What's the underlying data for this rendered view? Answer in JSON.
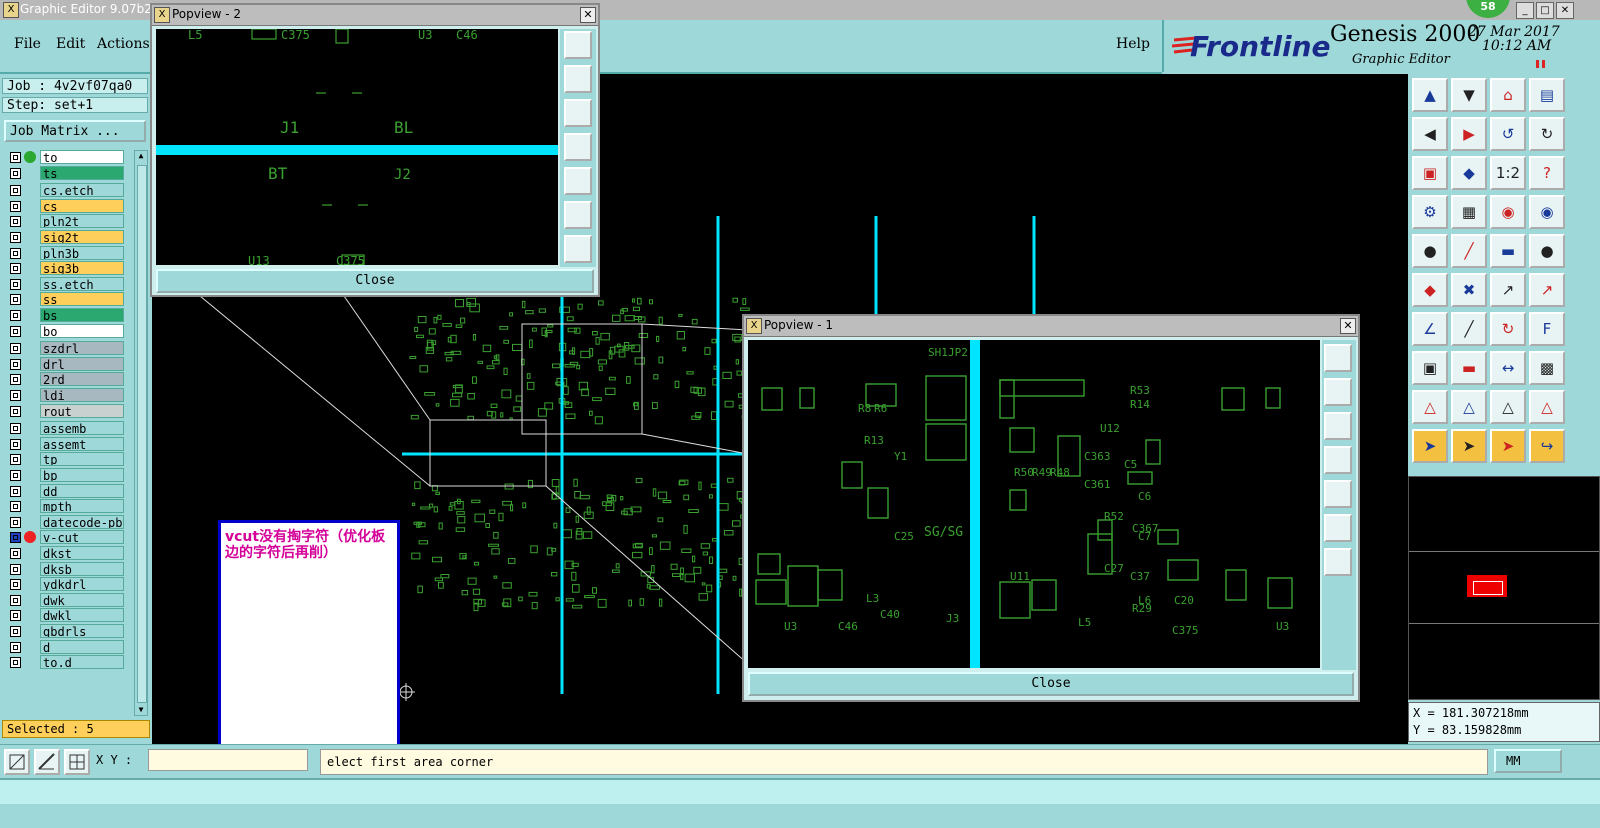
{
  "window": {
    "title": "Graphic Editor 9.07b2 (",
    "badge": "58"
  },
  "menu": {
    "file": "File",
    "edit": "Edit",
    "actions": "Actions",
    "help": "Help"
  },
  "brand": {
    "logo": "Frontline",
    "product": "Genesis 2000",
    "subtitle": "Graphic Editor",
    "date": "27 Mar 2017",
    "time": "10:12 AM"
  },
  "job": {
    "job_line": "Job : 4v2vf07qa0",
    "step_line": "Step: set+1",
    "matrix_button": "Job Matrix ..."
  },
  "layers": [
    {
      "name": "to",
      "color": "#ffffff"
    },
    {
      "name": "ts",
      "color": "#2aa870"
    },
    {
      "name": "cs.etch",
      "color": "#9fd8d8"
    },
    {
      "name": "cs",
      "color": "#ffcf5c"
    },
    {
      "name": "pln2t",
      "color": "#9fd8d8"
    },
    {
      "name": "sig2t",
      "color": "#ffcf5c"
    },
    {
      "name": "pln3b",
      "color": "#9fd8d8"
    },
    {
      "name": "sig3b",
      "color": "#ffcf5c"
    },
    {
      "name": "ss.etch",
      "color": "#9fd8d8"
    },
    {
      "name": "ss",
      "color": "#ffcf5c"
    },
    {
      "name": "bs",
      "color": "#2aa870"
    },
    {
      "name": "bo",
      "color": "#ffffff"
    },
    {
      "name": "szdrl",
      "color": "#a8b8c0"
    },
    {
      "name": "drl",
      "color": "#a8b8c0"
    },
    {
      "name": "2rd",
      "color": "#a8b8c0"
    },
    {
      "name": "ldi",
      "color": "#a8b8c0"
    },
    {
      "name": "rout",
      "color": "#c8d0d0"
    },
    {
      "name": "assemb",
      "color": "#9fd8d8"
    },
    {
      "name": "assemt",
      "color": "#9fd8d8"
    },
    {
      "name": "tp",
      "color": "#9fd8d8"
    },
    {
      "name": "bp",
      "color": "#9fd8d8"
    },
    {
      "name": "dd",
      "color": "#9fd8d8"
    },
    {
      "name": "mpth",
      "color": "#9fd8d8"
    },
    {
      "name": "datecode-pbe",
      "color": "#9fd8d8"
    },
    {
      "name": "v-cut",
      "color": "#9fd8d8"
    },
    {
      "name": "dkst",
      "color": "#9fd8d8"
    },
    {
      "name": "dksb",
      "color": "#9fd8d8"
    },
    {
      "name": "ydkdrl",
      "color": "#9fd8d8"
    },
    {
      "name": "dwk",
      "color": "#9fd8d8"
    },
    {
      "name": "dwkl",
      "color": "#9fd8d8"
    },
    {
      "name": "gbdrls",
      "color": "#9fd8d8"
    },
    {
      "name": "d",
      "color": "#9fd8d8"
    },
    {
      "name": "to.d",
      "color": "#9fd8d8"
    }
  ],
  "selected": "Selected : 5",
  "popview2": {
    "title": "Popview - 2",
    "close": "Close",
    "labels": {
      "l1": "C375",
      "l2": "U3",
      "l3": "C46",
      "l4": "L5",
      "l5": "J1",
      "l6": "BL",
      "l7": "BT",
      "l8": "J2",
      "l9": "U13",
      "l10": "C375"
    }
  },
  "popview1": {
    "title": "Popview - 1",
    "close": "Close",
    "labels": {
      "a": "SH1",
      "b": "JP2",
      "c": "R53",
      "d": "R14",
      "e": "U12",
      "f": "C363",
      "g": "C361",
      "h": "R52",
      "i": "C367",
      "j": "U11",
      "k": "C37",
      "l": "C27",
      "m": "R29",
      "n": "C20",
      "o": "L5",
      "p": "C375",
      "q": "U3",
      "r": "C46",
      "s": "L3",
      "t": "C40",
      "u": "Y1",
      "v": "R50",
      "w": "R49",
      "x": "R48",
      "y": "C25",
      "z": "L6",
      "sg": "SG/SG",
      "j3": "J3",
      "c5": "C5",
      "c6": "C6",
      "c7": "C7",
      "r6": "R6",
      "r8": "R8",
      "r13": "R13"
    }
  },
  "note": {
    "text": "vcut没有掏字符（优化板边的字符后再削）"
  },
  "bottom": {
    "xy_label": "X Y :",
    "xy_value": "",
    "prompt": "elect first area corner",
    "units": "MM"
  },
  "coords": {
    "x": "X = 181.307218mm",
    "y": "Y = 83.159828mm"
  },
  "colors": {
    "background": "#000000",
    "trace": "#3aa030",
    "vcut": "#00e5ff",
    "menu_bg": "#9fd8d8",
    "note_text": "#d40098",
    "note_border": "#0000cc"
  }
}
